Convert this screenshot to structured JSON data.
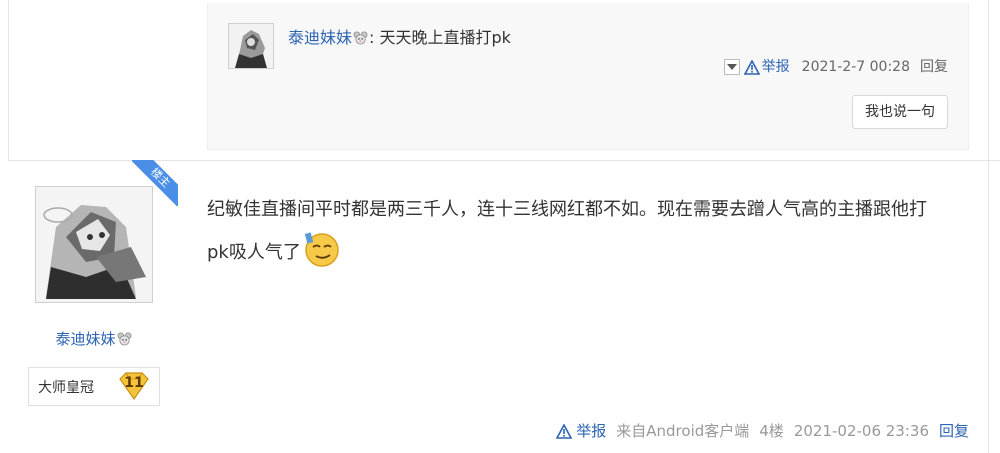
{
  "reply": {
    "username": "泰迪妹妹",
    "separator": ": ",
    "text": "天天晚上直播打pk",
    "report_label": "举报",
    "time": "2021-2-7 00:28",
    "reply_label": "回复",
    "say_button": "我也说一句"
  },
  "floor": {
    "ribbon_label": "楼主",
    "author_name": "泰迪妹妹",
    "level_title": "大师皇冠",
    "level_number": "11",
    "content_line1": "纪敏佳直播间平时都是两三千人，连十三线网红都不如。现在需要去蹭人气高的主播跟他打",
    "content_line2": "pk吸人气了",
    "report_label": "举报",
    "source": "来自Android客户端",
    "floor_number": "4楼",
    "time": "2021-02-06 23:36",
    "reply_label": "回复"
  },
  "colors": {
    "link": "#2d64b3",
    "ribbon": "#4a8ee8",
    "badge": "#f5c33b"
  }
}
